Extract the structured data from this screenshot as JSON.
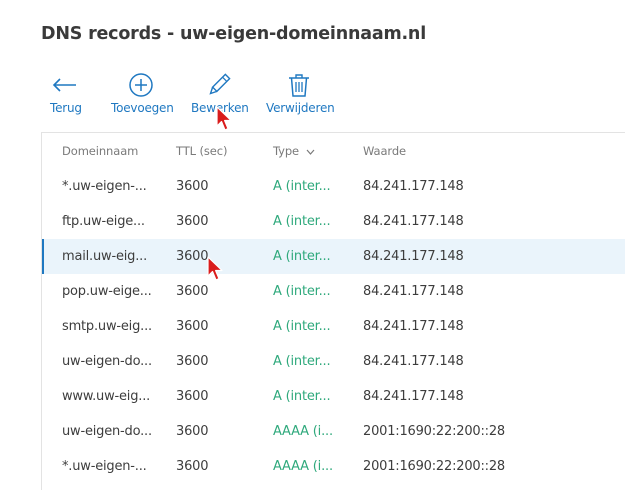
{
  "page": {
    "title": "DNS records - uw-eigen-domeinnaam.nl"
  },
  "toolbar": {
    "items": [
      {
        "label": "Terug",
        "icon": "arrow-left-icon"
      },
      {
        "label": "Toevoegen",
        "icon": "plus-circle-icon"
      },
      {
        "label": "Bewerken",
        "icon": "pencil-icon"
      },
      {
        "label": "Verwijderen",
        "icon": "trash-icon"
      }
    ]
  },
  "table": {
    "columns": [
      "Domeinnaam",
      "TTL (sec)",
      "Type",
      "Waarde"
    ],
    "sort_icon": "chevron-down-icon",
    "rows": [
      {
        "domain": "*.uw-eigen-...",
        "ttl": "3600",
        "type": "A (inter...",
        "value": "84.241.177.148"
      },
      {
        "domain": "ftp.uw-eige...",
        "ttl": "3600",
        "type": "A (inter...",
        "value": "84.241.177.148"
      },
      {
        "domain": "mail.uw-eig...",
        "ttl": "3600",
        "type": "A (inter...",
        "value": "84.241.177.148",
        "selected": true
      },
      {
        "domain": "pop.uw-eige...",
        "ttl": "3600",
        "type": "A (inter...",
        "value": "84.241.177.148"
      },
      {
        "domain": "smtp.uw-eig...",
        "ttl": "3600",
        "type": "A (inter...",
        "value": "84.241.177.148"
      },
      {
        "domain": "uw-eigen-do...",
        "ttl": "3600",
        "type": "A (inter...",
        "value": "84.241.177.148"
      },
      {
        "domain": "www.uw-eig...",
        "ttl": "3600",
        "type": "A (inter...",
        "value": "84.241.177.148"
      },
      {
        "domain": "uw-eigen-do...",
        "ttl": "3600",
        "type": "AAAA (i...",
        "value": "2001:1690:22:200::28"
      },
      {
        "domain": "*.uw-eigen-...",
        "ttl": "3600",
        "type": "AAAA (i...",
        "value": "2001:1690:22:200::28"
      }
    ]
  },
  "colors": {
    "accent": "#1f78c1",
    "type_text": "#2fa97c",
    "selected_row": "#eaf4fb",
    "cursor": "#d91c1c"
  }
}
